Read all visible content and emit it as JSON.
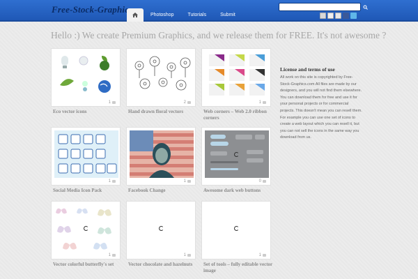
{
  "header": {
    "logo": "Free-Stock-Graphics",
    "nav": [
      {
        "label": "Photoshop"
      },
      {
        "label": "Tutorials"
      },
      {
        "label": "Submit"
      }
    ],
    "search": {
      "placeholder": ""
    },
    "social_icons": [
      "rss-icon",
      "email-icon",
      "flickr-icon",
      "facebook-icon",
      "twitter-icon"
    ]
  },
  "headline": "Hello :) We create Premium Graphics, and we release them for FREE. It's not awesome ?",
  "cards": [
    {
      "caption": "Eco vector icons",
      "comments": "1"
    },
    {
      "caption": "Hand drawn floral vectors",
      "comments": "2"
    },
    {
      "caption": "Web corners – Web 2.0 ribbon corners",
      "comments": "1"
    },
    {
      "caption": "Social Media Icon Pack",
      "comments": "1"
    },
    {
      "caption": "Facebook Change",
      "comments": "1"
    },
    {
      "caption": "Awesome dark web buttons",
      "comments": "0"
    },
    {
      "caption": "Vector colorful butterfly's set",
      "comments": "1"
    },
    {
      "caption": "Vector chocolate and hazelnuts",
      "comments": "1"
    },
    {
      "caption": "Set of tools – fully editable vector image",
      "comments": "1"
    }
  ],
  "sidebar": {
    "title": "License and terms of use",
    "text": "All work on this site is copyrighted by Free-Stock-Graphics.com All files are made by our designers, and you will not find them elsewhere. You can download them for free and use it for your personal projects or for commercial projects. This doesn't mean you can resell them. For example you can use one set of icons to create a web layout which you can resell it, but you can not sell the icons in the same way you download from us."
  },
  "colors": {
    "header_blue": "#2565c6",
    "logo": "#0b2c66",
    "headline": "#a7a7a7",
    "caption": "#8a8a8a"
  }
}
